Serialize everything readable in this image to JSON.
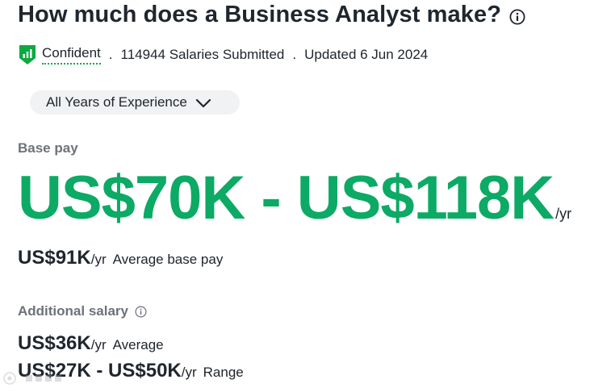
{
  "header": {
    "title": "How much does a Business Analyst make?",
    "title_icon": "info-circle-icon"
  },
  "meta": {
    "confidence_icon": "shield-bars-icon",
    "confidence_label": "Confident",
    "separator": ".",
    "salaries_submitted": "114944 Salaries Submitted",
    "updated": "Updated 6 Jun 2024"
  },
  "filter": {
    "experience_selected": "All Years of Experience",
    "dropdown_icon": "chevron-down-icon"
  },
  "base_pay": {
    "label": "Base pay",
    "range": "US$70K - US$118K",
    "range_unit": "/yr",
    "average_value": "US$91K",
    "average_unit": "/yr",
    "average_label": "Average base pay"
  },
  "additional_salary": {
    "label": "Additional salary",
    "label_icon": "info-circle-icon",
    "average_value": "US$36K",
    "average_unit": "/yr",
    "average_label": "Average",
    "range_value": "US$27K - US$50K",
    "range_unit": "/yr",
    "range_label": "Range"
  },
  "colors": {
    "accent_green": "#0caa65",
    "text_dark": "#20262e",
    "text_muted": "#6d727a",
    "pill_bg": "#f1f2f3"
  }
}
